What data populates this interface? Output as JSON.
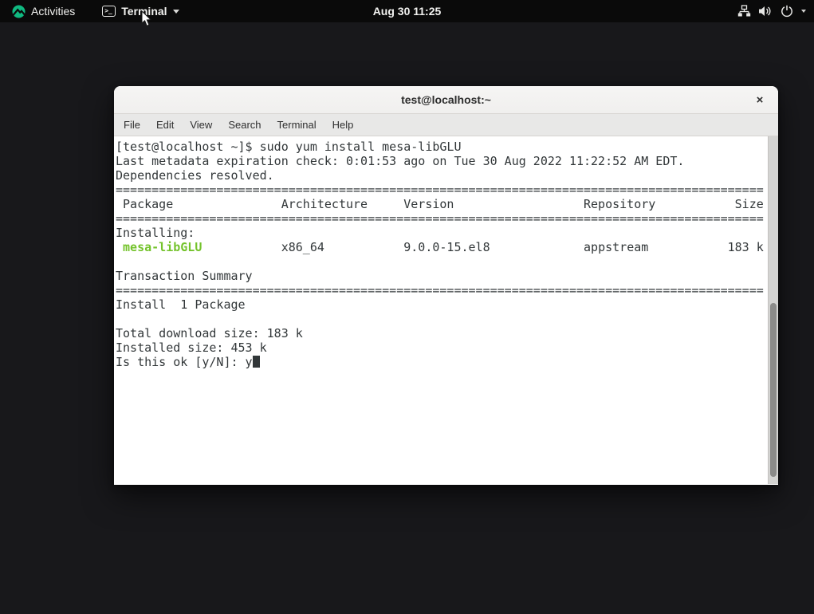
{
  "colors": {
    "topbar_bg": "#0a0a0a",
    "topbar_fg": "#f2f2f0",
    "desktop": "#18181b",
    "titlebar_bg": "#f3f2f1",
    "titlebar_fg": "#2d2d2d",
    "menubar_bg": "#e8e8e7",
    "term_bg": "#ffffff",
    "term_fg": "#323739",
    "accent_green": "#74c32c",
    "scroll_track": "#d3d3d1",
    "scroll_thumb": "#8b8b89"
  },
  "top_bar": {
    "activities_label": "Activities",
    "app_menu_label": "Terminal",
    "clock": "Aug 30  11:25",
    "icons": [
      "rocky-linux-logo",
      "terminal-app-icon",
      "chevron-down-icon",
      "network-wired-icon",
      "volume-icon",
      "power-icon",
      "chevron-down-icon"
    ]
  },
  "window": {
    "title": "test@localhost:~",
    "close_label": "×",
    "menubar": {
      "items": [
        "File",
        "Edit",
        "View",
        "Search",
        "Terminal",
        "Help"
      ]
    },
    "terminal": {
      "separator": "==========================================================================================",
      "lines": [
        {
          "segments": [
            {
              "t": "[test@localhost ~]$ sudo yum install mesa-libGLU"
            }
          ]
        },
        {
          "segments": [
            {
              "t": "Last metadata expiration check: 0:01:53 ago on Tue 30 Aug 2022 11:22:52 AM EDT."
            }
          ]
        },
        {
          "segments": [
            {
              "t": "Dependencies resolved."
            }
          ]
        },
        {
          "segments": [
            {
              "sep": true
            }
          ]
        },
        {
          "segments": [
            {
              "t": " Package               Architecture     Version                  Repository           Size"
            }
          ]
        },
        {
          "segments": [
            {
              "sep": true
            }
          ]
        },
        {
          "segments": [
            {
              "t": "Installing:"
            }
          ]
        },
        {
          "segments": [
            {
              "t": " "
            },
            {
              "t": "mesa-libGLU",
              "c": "green",
              "b": true
            },
            {
              "t": "           x86_64           9.0.0-15.el8             appstream           183 k"
            }
          ]
        },
        {
          "segments": [
            {
              "t": ""
            }
          ]
        },
        {
          "segments": [
            {
              "t": "Transaction Summary"
            }
          ]
        },
        {
          "segments": [
            {
              "sep": true
            }
          ]
        },
        {
          "segments": [
            {
              "t": "Install  1 Package"
            }
          ]
        },
        {
          "segments": [
            {
              "t": ""
            }
          ]
        },
        {
          "segments": [
            {
              "t": "Total download size: 183 k"
            }
          ]
        },
        {
          "segments": [
            {
              "t": "Installed size: 453 k"
            }
          ]
        },
        {
          "segments": [
            {
              "t": "Is this ok [y/N]: y"
            }
          ],
          "cursor": true
        }
      ]
    }
  }
}
